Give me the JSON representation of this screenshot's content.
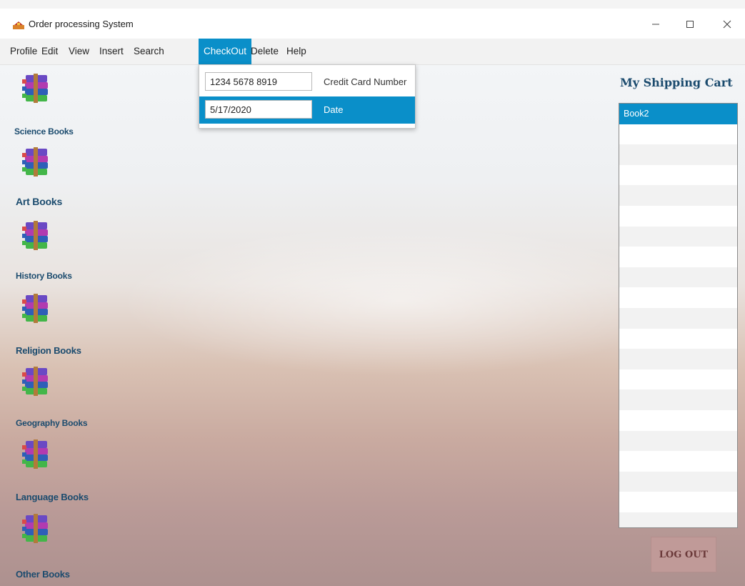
{
  "window": {
    "title": "Order processing System"
  },
  "menu": {
    "items": [
      "Profile",
      "Edit",
      "View",
      "Insert",
      "Search",
      "CheckOut",
      "Delete",
      "Help"
    ],
    "active": "CheckOut"
  },
  "checkout_dropdown": {
    "card_number": {
      "value": "1234 5678 8919",
      "label": "Credit Card Number"
    },
    "date": {
      "value": "5/17/2020",
      "label": "Date"
    }
  },
  "categories": [
    {
      "label": "Science Books"
    },
    {
      "label": "Art Books"
    },
    {
      "label": "History Books"
    },
    {
      "label": "Religion Books"
    },
    {
      "label": "Geography Books"
    },
    {
      "label": "Language Books"
    },
    {
      "label": "Other Books"
    }
  ],
  "cart": {
    "title": "My Shipping Cart",
    "items": [
      "Book2"
    ]
  },
  "logout": {
    "label": "LOG OUT"
  },
  "colors": {
    "accent": "#0a8fc9",
    "heading": "#1b4b6e",
    "logout_bg": "#c09a98"
  }
}
